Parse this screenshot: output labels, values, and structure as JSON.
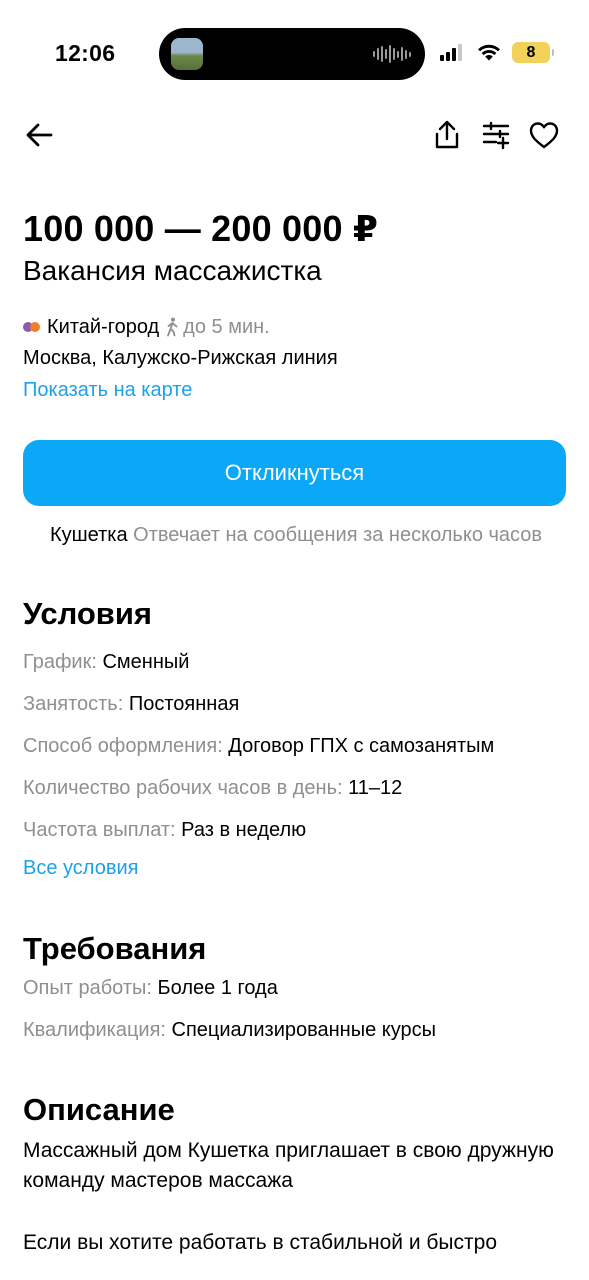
{
  "status_bar": {
    "time": "12:06",
    "battery_level": "8",
    "battery_color": "#f2d35a"
  },
  "nav": {
    "back_icon": "arrow-left-icon",
    "share_icon": "share-icon",
    "filter_icon": "sliders-icon",
    "favorite_icon": "heart-icon"
  },
  "vacancy": {
    "salary": "100 000 — 200 000 ₽",
    "title": "Вакансия массажистка",
    "metro_station": "Китай-город",
    "metro_colors": [
      "#8d5bb5",
      "#f37b2b"
    ],
    "walk_time": "до 5 мин.",
    "address": "Москва, Калужско-Рижская линия",
    "map_link": "Показать на карте"
  },
  "apply": {
    "button_label": "Откликнуться",
    "company": "Кушетка",
    "response_note": "Отвечает на сообщения за несколько часов",
    "accent_color": "#0aa8f7"
  },
  "conditions": {
    "title": "Условия",
    "rows": [
      {
        "key": "График:",
        "value": "Сменный"
      },
      {
        "key": "Занятость:",
        "value": "Постоянная"
      },
      {
        "key": "Способ оформления:",
        "value": "Договор ГПХ с самозанятым"
      },
      {
        "key": "Количество рабочих часов в день:",
        "value": "11–12"
      },
      {
        "key": "Частота выплат:",
        "value": "Раз в неделю"
      }
    ],
    "all_link": "Все условия"
  },
  "requirements": {
    "title": "Требования",
    "rows": [
      {
        "key": "Опыт работы:",
        "value": "Более 1 года"
      },
      {
        "key": "Квалификация:",
        "value": "Специализированные курсы"
      }
    ]
  },
  "description": {
    "title": "Описание",
    "paragraphs": [
      "Массажный дом Кушетка приглашает в свою дружную команду мастеров массажа",
      "Если вы хотите работать в стабильной и быстро"
    ]
  }
}
